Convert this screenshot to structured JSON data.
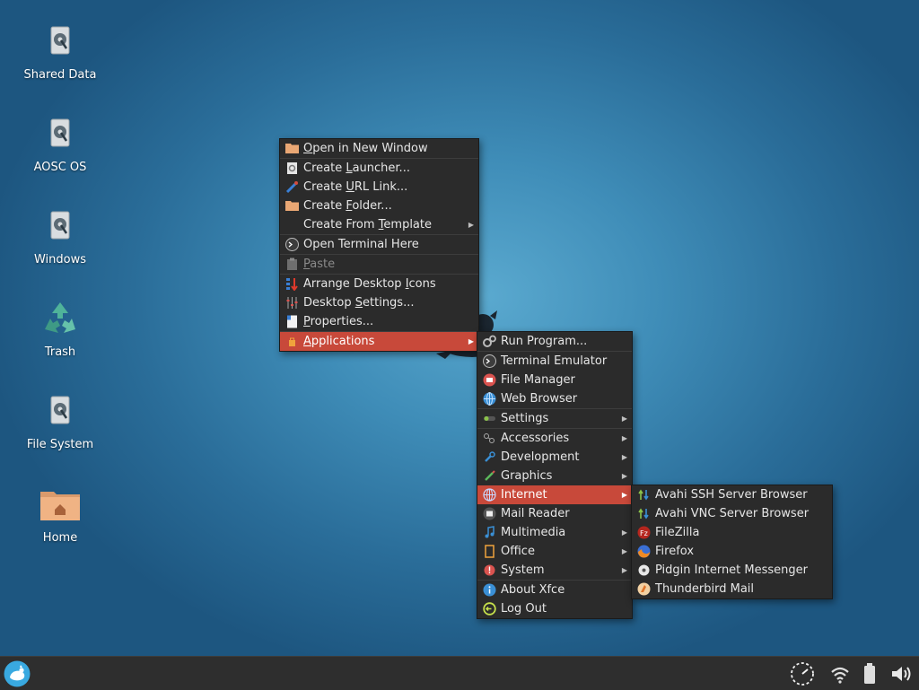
{
  "desktop": {
    "icons": [
      {
        "label": "Shared Data",
        "icon": "drive-icon"
      },
      {
        "label": "AOSC OS",
        "icon": "drive-icon"
      },
      {
        "label": "Windows",
        "icon": "drive-icon"
      },
      {
        "label": "Trash",
        "icon": "recycle-icon"
      },
      {
        "label": "File System",
        "icon": "drive-icon"
      },
      {
        "label": "Home",
        "icon": "home-folder-icon"
      }
    ]
  },
  "context_menu": {
    "items": [
      {
        "pre": "",
        "u": "O",
        "post": "pen in New Window",
        "icon": "folder-icon"
      },
      {
        "pre": "Create ",
        "u": "L",
        "post": "auncher...",
        "icon": "launcher-icon"
      },
      {
        "pre": "Create ",
        "u": "U",
        "post": "RL Link...",
        "icon": "link-icon"
      },
      {
        "pre": "Create ",
        "u": "F",
        "post": "older...",
        "icon": "folder-icon"
      },
      {
        "pre": "Create From ",
        "u": "T",
        "post": "emplate",
        "icon": "none",
        "submenu": true
      },
      {
        "pre": "Open Terminal Here",
        "u": "",
        "post": "",
        "icon": "terminal-icon"
      },
      {
        "pre": "",
        "u": "P",
        "post": "aste",
        "icon": "clipboard-icon",
        "disabled": true
      },
      {
        "pre": "Arrange Desktop ",
        "u": "I",
        "post": "cons",
        "icon": "arrange-icon"
      },
      {
        "pre": "Desktop ",
        "u": "S",
        "post": "ettings...",
        "icon": "settings-sliders-icon"
      },
      {
        "pre": "",
        "u": "P",
        "post": "roperties...",
        "icon": "properties-icon"
      },
      {
        "pre": "",
        "u": "A",
        "post": "pplications",
        "icon": "bag-icon",
        "submenu": true,
        "active": true
      }
    ]
  },
  "applications_menu": {
    "items": [
      {
        "label": "Run Program...",
        "icon": "gears-icon"
      },
      {
        "label": "Terminal Emulator",
        "icon": "terminal-icon"
      },
      {
        "label": "File Manager",
        "icon": "file-manager-icon"
      },
      {
        "label": "Web Browser",
        "icon": "globe-icon"
      },
      {
        "label": "Settings",
        "icon": "settings-toggle-icon",
        "submenu": true
      },
      {
        "label": "Accessories",
        "icon": "accessories-icon",
        "submenu": true
      },
      {
        "label": "Development",
        "icon": "wrench-icon",
        "submenu": true
      },
      {
        "label": "Graphics",
        "icon": "pen-icon",
        "submenu": true
      },
      {
        "label": "Internet",
        "icon": "internet-globe-icon",
        "submenu": true,
        "active": true
      },
      {
        "label": "Mail Reader",
        "icon": "mail-icon"
      },
      {
        "label": "Multimedia",
        "icon": "music-note-icon",
        "submenu": true
      },
      {
        "label": "Office",
        "icon": "document-icon",
        "submenu": true
      },
      {
        "label": "System",
        "icon": "system-icon",
        "submenu": true
      },
      {
        "label": "About Xfce",
        "icon": "info-icon"
      },
      {
        "label": "Log Out",
        "icon": "logout-icon"
      }
    ]
  },
  "internet_menu": {
    "items": [
      {
        "label": "Avahi SSH Server Browser",
        "icon": "avahi-icon"
      },
      {
        "label": "Avahi VNC Server Browser",
        "icon": "avahi-icon"
      },
      {
        "label": "FileZilla",
        "icon": "filezilla-icon"
      },
      {
        "label": "Firefox",
        "icon": "firefox-icon"
      },
      {
        "label": "Pidgin Internet Messenger",
        "icon": "pidgin-icon"
      },
      {
        "label": "Thunderbird Mail",
        "icon": "thunderbird-icon"
      }
    ]
  },
  "taskbar": {
    "start_icon": "xfce-mouse-icon",
    "tray": [
      "clock-icon",
      "wifi-icon",
      "battery-icon",
      "volume-icon"
    ]
  },
  "colors": {
    "menu_bg": "#2b2b2b",
    "highlight": "#c8493a",
    "desktop_blue": "#3f8db8",
    "taskbar_bg": "#2e2e2e"
  }
}
